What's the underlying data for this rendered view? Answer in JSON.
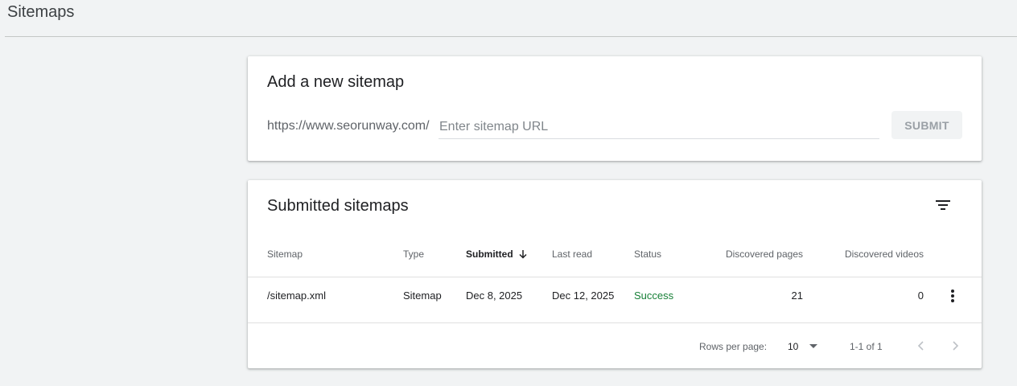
{
  "header": {
    "title": "Sitemaps"
  },
  "add_sitemap": {
    "title": "Add a new sitemap",
    "url_prefix": "https://www.seorunway.com/",
    "input_placeholder": "Enter sitemap URL",
    "input_value": "",
    "submit_label": "SUBMIT"
  },
  "submitted": {
    "title": "Submitted sitemaps",
    "filter_icon": "filter-list-icon",
    "columns": {
      "sitemap": "Sitemap",
      "type": "Type",
      "submitted": "Submitted",
      "last_read": "Last read",
      "status": "Status",
      "discovered_pages": "Discovered pages",
      "discovered_videos": "Discovered videos"
    },
    "sort": {
      "column": "submitted",
      "direction": "descending",
      "icon": "arrow-down-icon"
    },
    "rows": [
      {
        "sitemap": "/sitemap.xml",
        "type": "Sitemap",
        "submitted": "Dec 8, 2025",
        "last_read": "Dec 12, 2025",
        "status": "Success",
        "discovered_pages": "21",
        "discovered_videos": "0"
      }
    ],
    "pagination": {
      "rows_per_page_label": "Rows per page:",
      "rows_per_page_value": "10",
      "range_label": "1-1 of 1"
    }
  },
  "colors": {
    "background": "#f1f3f4",
    "success": "#188038",
    "muted_text": "#5f6368",
    "disabled_button_text": "#9aa0a6"
  }
}
